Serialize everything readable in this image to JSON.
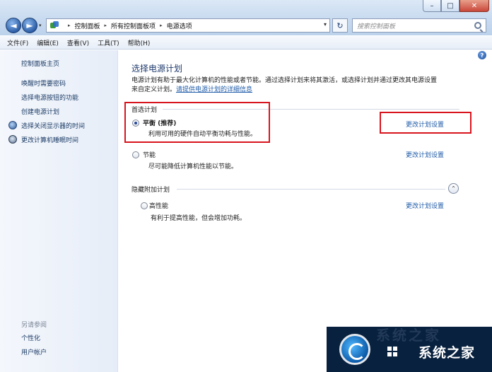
{
  "window": {
    "buttons": {
      "minimize": "–",
      "maximize": "□",
      "close": "✕"
    }
  },
  "nav": {
    "back_icon": "arrow-left-icon",
    "forward_icon": "arrow-right-icon",
    "back_glyph": "◄",
    "forward_glyph": "►",
    "history_glyph": "▾",
    "breadcrumbs": [
      "控制面板",
      "所有控制面板项",
      "电源选项"
    ],
    "crumb_sep": "▸",
    "dropdown_glyph": "▾",
    "refresh_glyph": "↻",
    "search_placeholder": "搜索控制面板"
  },
  "menu": {
    "items": [
      "文件(F)",
      "编辑(E)",
      "查看(V)",
      "工具(T)",
      "帮助(H)"
    ]
  },
  "sidebar": {
    "home": "控制面板主页",
    "links": [
      "唤醒时需要密码",
      "选择电源按钮的功能",
      "创建电源计划",
      "选择关闭显示器的时间",
      "更改计算机睡眠时间"
    ],
    "see_also_title": "另请参阅",
    "see_also": [
      "个性化",
      "用户帐户"
    ]
  },
  "main": {
    "help_glyph": "?",
    "title": "选择电源计划",
    "description_line1": "电源计划有助于最大化计算机的性能或者节能。通过选择计划来将其激活，或选择计划并通过更改其电源设置",
    "description_line2_prefix": "来自定义计划。",
    "description_link": "请提供电源计划的详细信息",
    "preferred_header": "首选计划",
    "hidden_header": "隐藏附加计划",
    "collapse_glyph": "⌃",
    "plans": [
      {
        "name": "平衡 (推荐)",
        "description": "利用可用的硬件自动平衡功耗与性能。",
        "link": "更改计划设置",
        "selected": true
      },
      {
        "name": "节能",
        "description": "尽可能降低计算机性能以节能。",
        "link": "更改计划设置",
        "selected": false
      },
      {
        "name": "高性能",
        "description": "有利于提高性能，但会增加功耗。",
        "link": "更改计划设置",
        "selected": false
      }
    ]
  },
  "watermark": {
    "top_text": "系统之家",
    "text": "系统之家"
  },
  "colors": {
    "link": "#1f5ba8",
    "title": "#1e3a6d",
    "highlight_box": "#d8141e"
  }
}
